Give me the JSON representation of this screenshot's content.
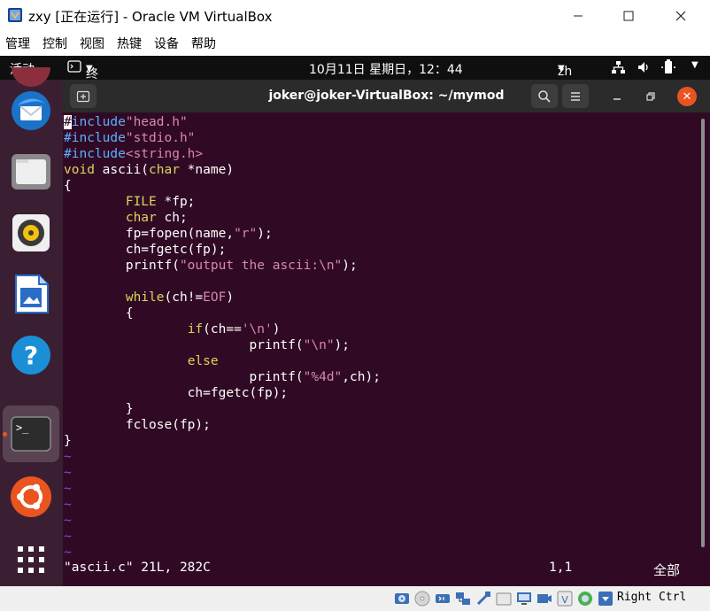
{
  "window": {
    "title": "zxy [正在运行] - Oracle VM VirtualBox",
    "menu": [
      "管理",
      "控制",
      "视图",
      "热键",
      "设备",
      "帮助"
    ]
  },
  "gnome": {
    "activities": "活动",
    "app_menu": "终端",
    "clock": "10月11日 星期日，12：44",
    "input_method": "zh"
  },
  "dock": {
    "items": [
      "thunderbird-mail",
      "files",
      "rhythmbox",
      "libreoffice-writer",
      "help",
      "terminal",
      "ubuntu-software",
      "show-applications"
    ],
    "active": "terminal"
  },
  "terminal": {
    "title": "joker@joker-VirtualBox: ~/mymod",
    "code": [
      "#include\"head.h\"",
      "#include\"stdio.h\"",
      "#include<string.h>",
      "void ascii(char *name)",
      "{",
      "        FILE *fp;",
      "        char ch;",
      "        fp=fopen(name,\"r\");",
      "        ch=fgetc(fp);",
      "        printf(\"output the ascii:\\n\");",
      "",
      "        while(ch!=EOF)",
      "        {",
      "                if(ch=='\\n')",
      "                        printf(\"\\n\");",
      "                else",
      "                        printf(\"%4d\",ch);",
      "                ch=fgetc(fp);",
      "        }",
      "        fclose(fp);",
      "}"
    ],
    "tilde_lines": 7,
    "status": {
      "file_info": "\"ascii.c\" 21L, 282C",
      "position": "1,1",
      "scroll": "全部"
    }
  },
  "vbox_status": {
    "host_key": "Right Ctrl"
  },
  "colors": {
    "ubuntu_orange": "#e95420",
    "terminal_bg": "#300a24",
    "preprocessor": "#5fafff",
    "string": "#d787af",
    "type": "#d7d75f",
    "tilde": "#5f5fd7"
  }
}
